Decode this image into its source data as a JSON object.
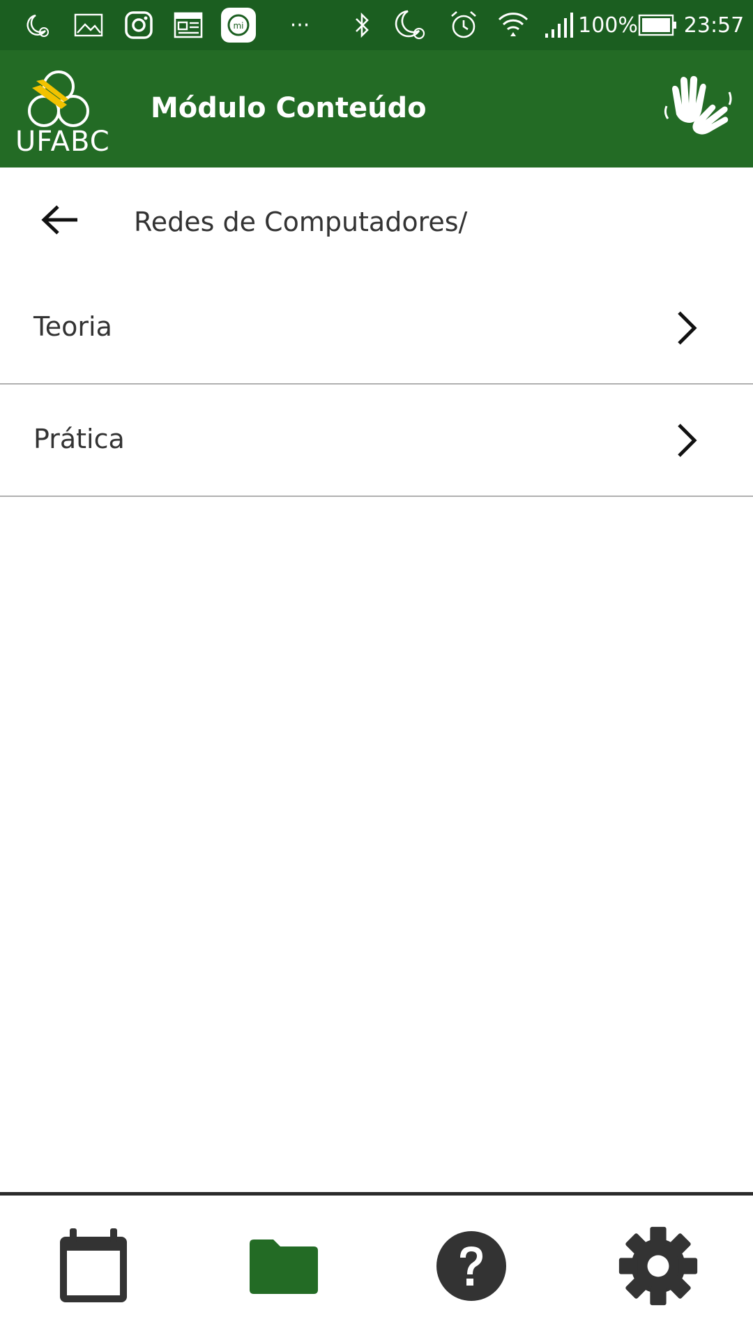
{
  "status_bar": {
    "battery_percent": "100%",
    "time": "23:57",
    "overflow": "···",
    "icons": [
      "moon-alarm-icon",
      "gallery-icon",
      "instagram-icon",
      "news-icon",
      "mi-icon",
      "bluetooth-icon",
      "moon-alarm-icon",
      "alarm-icon",
      "wifi-icon",
      "signal-icon",
      "battery-icon"
    ]
  },
  "app_bar": {
    "logo_text": "UFABC",
    "title": "Módulo Conteúdo",
    "accessibility_icon": "sign-language-icon"
  },
  "breadcrumb": {
    "path": "Redes de Computadores/"
  },
  "list": {
    "items": [
      {
        "label": "Teoria"
      },
      {
        "label": "Prática"
      }
    ]
  },
  "bottom_nav": {
    "items": [
      "calendar-icon",
      "folder-icon",
      "help-icon",
      "settings-icon"
    ],
    "active": "folder-icon"
  },
  "colors": {
    "status_bar": "#1b5e20",
    "app_bar": "#236b25",
    "accent": "#236b25",
    "nav_icon": "#333333",
    "logo_accent": "#f2c200"
  }
}
